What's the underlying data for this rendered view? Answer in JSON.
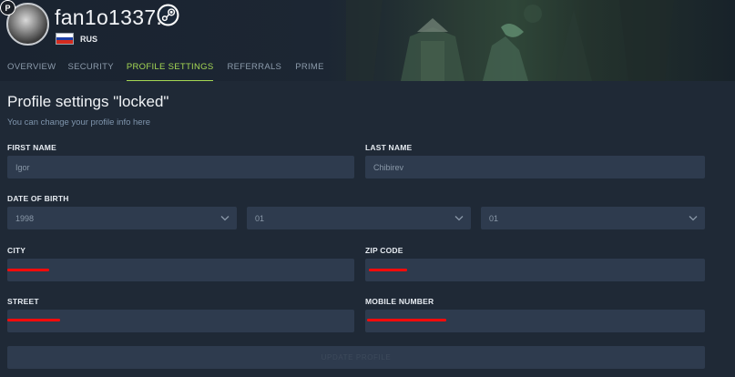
{
  "profile": {
    "username": "fan1o1337.-",
    "country_code": "RUS",
    "avatar_badge": "P"
  },
  "tabs": [
    {
      "label": "OVERVIEW",
      "active": false
    },
    {
      "label": "SECURITY",
      "active": false
    },
    {
      "label": "PROFILE SETTINGS",
      "active": true
    },
    {
      "label": "REFERRALS",
      "active": false
    },
    {
      "label": "PRIME",
      "active": false
    }
  ],
  "settings": {
    "title": "Profile settings \"locked\"",
    "subtitle": "You can change your profile info here"
  },
  "form": {
    "first_name": {
      "label": "FIRST NAME",
      "value": "Igor"
    },
    "last_name": {
      "label": "LAST NAME",
      "value": "Chibirev"
    },
    "dob": {
      "label": "DATE OF BIRTH",
      "year": "1998",
      "month": "01",
      "day": "01"
    },
    "city": {
      "label": "CITY",
      "value": ""
    },
    "zip": {
      "label": "ZIP CODE",
      "value": ""
    },
    "street": {
      "label": "STREET",
      "value": ""
    },
    "mobile": {
      "label": "MOBILE NUMBER",
      "value": ""
    },
    "submit_label": "UPDATE PROFILE"
  },
  "colors": {
    "accent": "#a6d854",
    "background": "#1f2936",
    "field_bg": "#2e3b4e",
    "redaction": "#ff0a0a"
  }
}
